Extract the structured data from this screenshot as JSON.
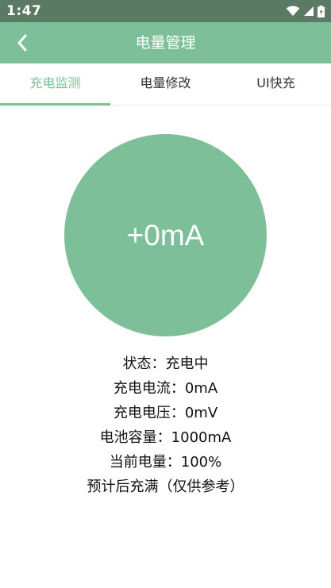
{
  "status_bar": {
    "time": "1:47",
    "icons": [
      "wifi-icon",
      "signal-icon",
      "battery-charging-icon"
    ]
  },
  "app_bar": {
    "title": "电量管理",
    "back_icon": "chevron-left-icon"
  },
  "tabs": [
    {
      "label": "充电监测",
      "selected": true
    },
    {
      "label": "电量修改",
      "selected": false
    },
    {
      "label": "UI快充",
      "selected": false
    }
  ],
  "gauge": {
    "value": "+0mA"
  },
  "info": {
    "lines": [
      "状态：充电中",
      "充电电流：0mA",
      "充电电压：0mV",
      "电池容量：1000mA",
      "当前电量：100%",
      "预计后充满（仅供参考）"
    ]
  },
  "colors": {
    "accent": "#7dbf98",
    "status_bar": "#5a7a64",
    "text": "#111111"
  }
}
